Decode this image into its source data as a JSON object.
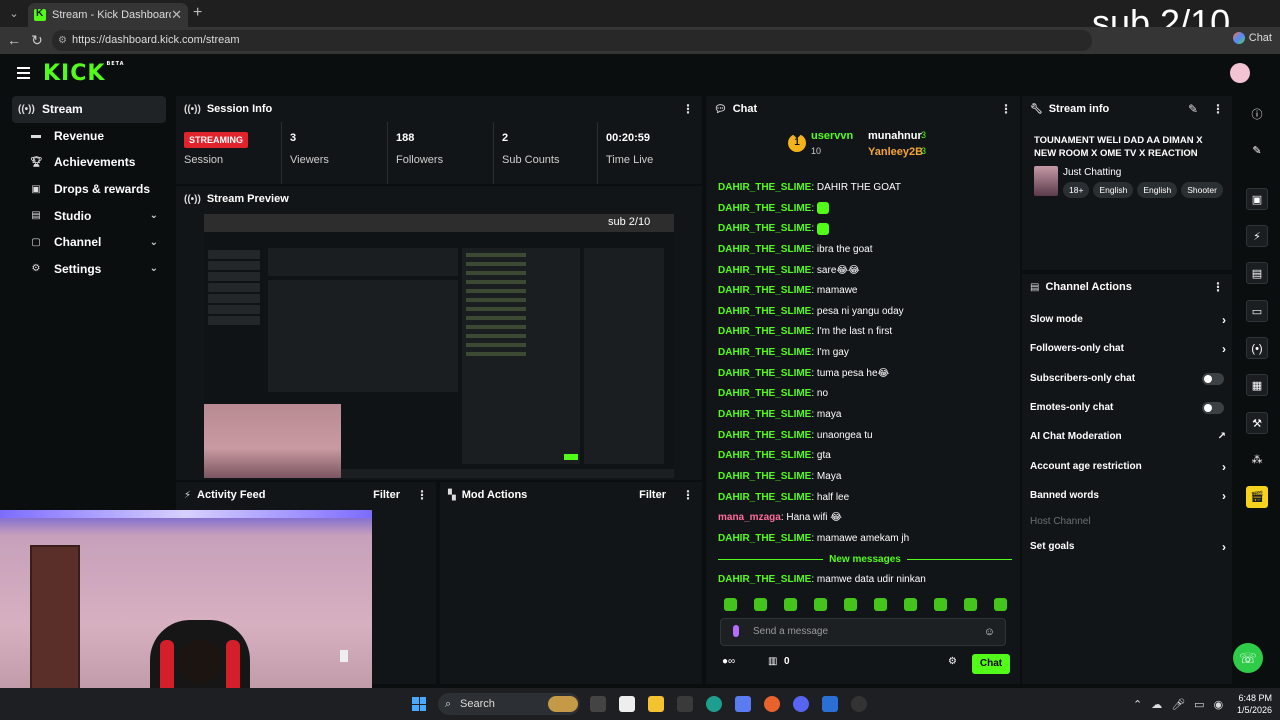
{
  "browser": {
    "tab_title": "Stream - Kick Dashboard",
    "url": "https://dashboard.kick.com/stream",
    "chat_button": "Chat",
    "overlay_text": "sub 2/10"
  },
  "sidebar": {
    "items": [
      {
        "label": "Stream",
        "icon": "stream-icon",
        "active": true
      },
      {
        "label": "Revenue",
        "icon": "wallet-icon"
      },
      {
        "label": "Achievements",
        "icon": "trophy-icon"
      },
      {
        "label": "Drops & rewards",
        "icon": "gift-icon"
      },
      {
        "label": "Studio",
        "icon": "studio-icon",
        "expandable": true
      },
      {
        "label": "Channel",
        "icon": "channel-icon",
        "expandable": true
      },
      {
        "label": "Settings",
        "icon": "gear-icon",
        "expandable": true
      }
    ]
  },
  "session": {
    "title": "Session Info",
    "status": "STREAMING",
    "status_label": "Session",
    "viewers": "3",
    "viewers_label": "Viewers",
    "followers": "188",
    "followers_label": "Followers",
    "subs": "2",
    "subs_label": "Sub Counts",
    "time_live": "00:20:59",
    "time_label": "Time Live"
  },
  "preview": {
    "title": "Stream Preview",
    "overlay_text": "sub 2/10"
  },
  "activity": {
    "title": "Activity Feed",
    "filter": "Filter"
  },
  "mod": {
    "title": "Mod Actions",
    "filter": "Filter"
  },
  "chat": {
    "title": "Chat",
    "top_gifters": [
      {
        "name": "uservvn",
        "count": "10"
      },
      {
        "name": "munahnur",
        "count": "3"
      },
      {
        "name": "Yanleey2B",
        "count": "3"
      }
    ],
    "messages": [
      {
        "user": "DAHIR_THE_SLIME",
        "text": "DAHIR THE GOAT"
      },
      {
        "user": "DAHIR_THE_SLIME",
        "text": "",
        "emote": true
      },
      {
        "user": "DAHIR_THE_SLIME",
        "text": "",
        "emote": true
      },
      {
        "user": "DAHIR_THE_SLIME",
        "text": "ibra the goat"
      },
      {
        "user": "DAHIR_THE_SLIME",
        "text": "sare😂😂"
      },
      {
        "user": "DAHIR_THE_SLIME",
        "text": "mamawe"
      },
      {
        "user": "DAHIR_THE_SLIME",
        "text": "pesa ni yangu oday"
      },
      {
        "user": "DAHIR_THE_SLIME",
        "text": "I'm the last n first"
      },
      {
        "user": "DAHIR_THE_SLIME",
        "text": "I'm gay"
      },
      {
        "user": "DAHIR_THE_SLIME",
        "text": "tuma pesa he😂"
      },
      {
        "user": "DAHIR_THE_SLIME",
        "text": "no"
      },
      {
        "user": "DAHIR_THE_SLIME",
        "text": "maya"
      },
      {
        "user": "DAHIR_THE_SLIME",
        "text": "unaongea tu"
      },
      {
        "user": "DAHIR_THE_SLIME",
        "text": "gta"
      },
      {
        "user": "DAHIR_THE_SLIME",
        "text": "Maya"
      },
      {
        "user": "DAHIR_THE_SLIME",
        "text": "half lee"
      },
      {
        "user": "mana_mzaga",
        "text": "Hana wifi 😂",
        "pink": true
      },
      {
        "user": "DAHIR_THE_SLIME",
        "text": "mamawe amekam jh"
      }
    ],
    "new_messages_label": "New messages",
    "after_messages": [
      {
        "user": "DAHIR_THE_SLIME",
        "text": "mamwe data udir ninkan"
      }
    ],
    "input_placeholder": "Send a message",
    "points": "0",
    "send_button": "Chat"
  },
  "stream_info": {
    "title": "Stream info",
    "stream_title": "TOUNAMENT WELI DAD AA DIMAN X NEW ROOM X OME TV X REACTION",
    "category": "Just Chatting",
    "tags": [
      "18+",
      "English",
      "English",
      "Shooter"
    ]
  },
  "channel_actions": {
    "title": "Channel Actions",
    "items": [
      {
        "label": "Slow mode",
        "kind": "arrow"
      },
      {
        "label": "Followers-only chat",
        "kind": "arrow"
      },
      {
        "label": "Subscribers-only chat",
        "kind": "toggle"
      },
      {
        "label": "Emotes-only chat",
        "kind": "toggle"
      },
      {
        "label": "AI Chat Moderation",
        "kind": "external"
      },
      {
        "label": "Account age restriction",
        "kind": "arrow"
      },
      {
        "label": "Banned words",
        "kind": "arrow"
      },
      {
        "label": "Host Channel",
        "kind": "disabled"
      },
      {
        "label": "Set goals",
        "kind": "arrow"
      }
    ]
  },
  "taskbar": {
    "search": "Search",
    "time": "6:48 PM",
    "date": "1/5/2026"
  },
  "colors": {
    "accent": "#53fc18",
    "streaming": "#e1232d",
    "panel": "#121517"
  }
}
